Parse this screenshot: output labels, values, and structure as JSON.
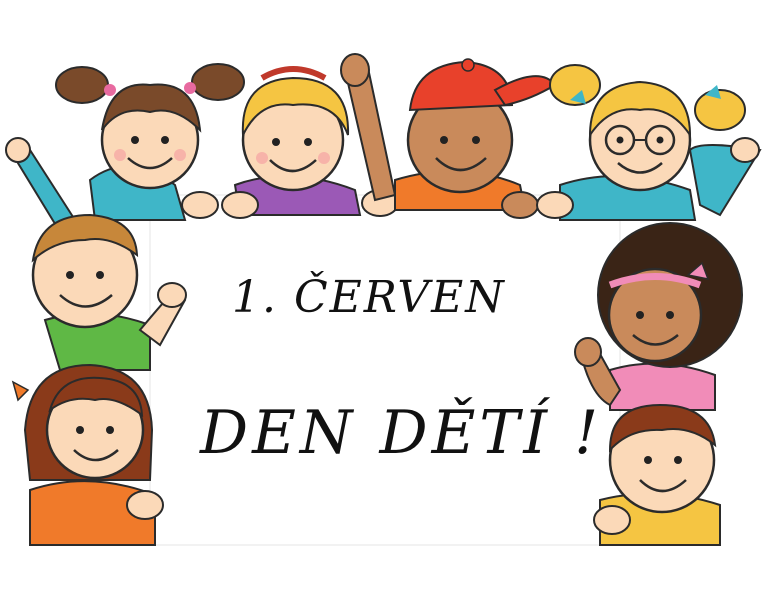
{
  "sign": {
    "line1": "1. ČERVEN",
    "line2": "DEN DĚTÍ !"
  },
  "illustration": {
    "subject": "cartoon children holding a white sign",
    "children_count": 8,
    "colors": {
      "sign": "#ffffff",
      "skin_light": "#fbd9b8",
      "skin_dark": "#c98a5b",
      "cap": "#e8412b",
      "shirt_orange": "#f07a2a",
      "shirt_green": "#5fb845",
      "shirt_purple": "#9b59b6",
      "shirt_teal": "#3fb6c8",
      "hair_brown": "#7a4a2a",
      "hair_blonde": "#f5c542",
      "hair_black": "#3a2416",
      "outline": "#2b2b2b"
    }
  }
}
